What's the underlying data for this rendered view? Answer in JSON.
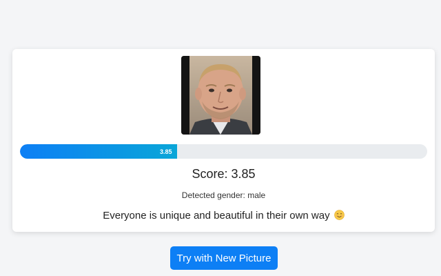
{
  "result": {
    "photo_alt": "Uploaded face photo",
    "score_value": 3.85,
    "score_max": 10,
    "score_bar_label": "3.85",
    "score_text": "Score: 3.85",
    "gender_text": "Detected gender: male",
    "message_text": "Everyone is unique and beautiful in their own way",
    "message_emoji": "smiling-face-icon"
  },
  "actions": {
    "try_again_label": "Try with New Picture"
  },
  "colors": {
    "accent": "#0d7ff5",
    "bar_track": "#e9ecef",
    "background": "#f4f5f7"
  }
}
